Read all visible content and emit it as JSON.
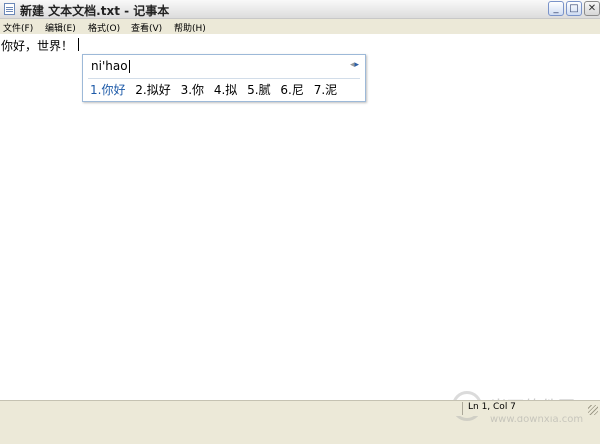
{
  "window": {
    "title": "新建 文本文档.txt - 记事本",
    "buttons": {
      "minimize": "_",
      "maximize": "□",
      "close": "✕"
    }
  },
  "menu": [
    {
      "label": "文件(F)"
    },
    {
      "label": "编辑(E)"
    },
    {
      "label": "格式(O)"
    },
    {
      "label": "查看(V)"
    },
    {
      "label": "帮助(H)"
    }
  ],
  "editor": {
    "content": "你好，世界！"
  },
  "ime": {
    "composition": "ni'hao",
    "page_prev": "◂",
    "page_next": "▸",
    "candidates": [
      "1.你好",
      "2.拟好",
      "3.你",
      "4.拟",
      "5.腻",
      "6.尼",
      "7.泥"
    ],
    "selected_index": 0
  },
  "status": {
    "position": "Ln 1, Col 7"
  },
  "watermark": {
    "text": "当下软件园",
    "url": "www.downxia.com"
  }
}
